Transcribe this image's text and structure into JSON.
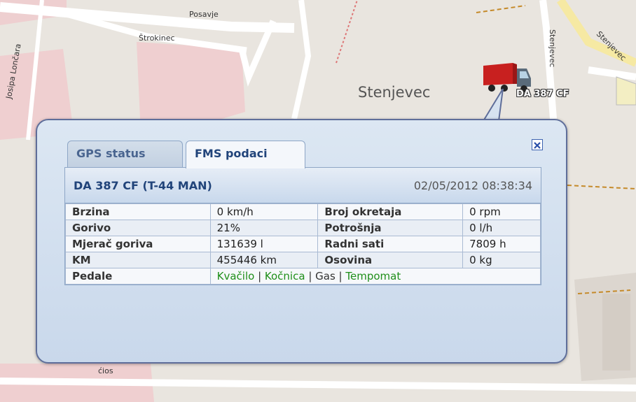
{
  "map": {
    "place_label": "Stenjevec",
    "street_labels": [
      "Posavje",
      "Štrokinec",
      "Josipa Lončara",
      "Stenjevec",
      "Stenjevec",
      "ćios"
    ],
    "vehicle_label": "DA 387 CF",
    "vehicle_icon": "truck-icon"
  },
  "popup": {
    "tabs": [
      {
        "label": "GPS status",
        "active": false
      },
      {
        "label": "FMS podaci",
        "active": true
      }
    ],
    "close_icon": "close-icon",
    "header": {
      "vehicle": "DA 387 CF (T-44 MAN)",
      "timestamp": "02/05/2012 08:38:34"
    },
    "rows": [
      {
        "label1": "Brzina",
        "value1": "0 km/h",
        "label2": "Broj okretaja",
        "value2": "0 rpm"
      },
      {
        "label1": "Gorivo",
        "value1": "21%",
        "label2": "Potrošnja",
        "value2": "0 l/h"
      },
      {
        "label1": "Mjerač goriva",
        "value1": "131639 l",
        "label2": "Radni sati",
        "value2": "7809 h"
      },
      {
        "label1": "KM",
        "value1": "455446 km",
        "label2": "Osovina",
        "value2": "0 kg"
      }
    ],
    "pedals": {
      "label": "Pedale",
      "items": [
        {
          "name": "Kvačilo",
          "active": true
        },
        {
          "name": "Kočnica",
          "active": true
        },
        {
          "name": "Gas",
          "active": false
        },
        {
          "name": "Tempomat",
          "active": true
        }
      ],
      "separator": " | "
    }
  },
  "colors": {
    "active_green": "#1f8f1a",
    "tab_text": "#21447a",
    "popup_border": "#5f6e9a"
  }
}
